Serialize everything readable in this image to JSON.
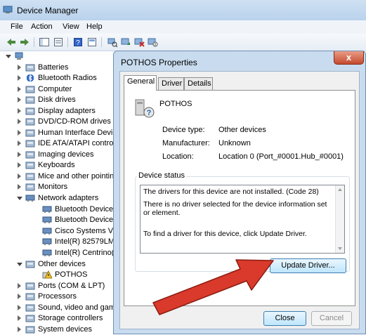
{
  "window": {
    "title": "Device Manager"
  },
  "menu": {
    "items": [
      "File",
      "Action",
      "View",
      "Help"
    ]
  },
  "tree": {
    "items": [
      {
        "label": "Batteries"
      },
      {
        "label": "Bluetooth Radios"
      },
      {
        "label": "Computer"
      },
      {
        "label": "Disk drives"
      },
      {
        "label": "Display adapters"
      },
      {
        "label": "DVD/CD-ROM drives"
      },
      {
        "label": "Human Interface Devic"
      },
      {
        "label": "IDE ATA/ATAPI contro"
      },
      {
        "label": "Imaging devices"
      },
      {
        "label": "Keyboards"
      },
      {
        "label": "Mice and other pointin"
      },
      {
        "label": "Monitors"
      },
      {
        "label": "Network adapters"
      },
      {
        "label": "Bluetooth Device ("
      },
      {
        "label": "Bluetooth Device ("
      },
      {
        "label": "Cisco Systems VPN"
      },
      {
        "label": "Intel(R) 82579LM G"
      },
      {
        "label": "Intel(R) Centrino(R"
      },
      {
        "label": "Other devices"
      },
      {
        "label": "POTHOS"
      },
      {
        "label": "Ports (COM & LPT)"
      },
      {
        "label": "Processors"
      },
      {
        "label": "Sound, video and gam"
      },
      {
        "label": "Storage controllers"
      },
      {
        "label": "System devices"
      }
    ]
  },
  "dialog": {
    "title": "POTHOS Properties",
    "close_glyph": "x",
    "tabs": [
      "General",
      "Driver",
      "Details"
    ],
    "device_name": "POTHOS",
    "properties": [
      {
        "label": "Device type:",
        "value": "Other devices"
      },
      {
        "label": "Manufacturer:",
        "value": "Unknown"
      },
      {
        "label": "Location:",
        "value": "Location 0 (Port_#0001.Hub_#0001)"
      }
    ],
    "status_group_label": "Device status",
    "status_lines": [
      "The drivers for this device are not installed. (Code 28)",
      "There is no driver selected for the device information set or element.",
      "To find a driver for this device, click Update Driver."
    ],
    "update_button": "Update Driver...",
    "close_button": "Close",
    "cancel_button": "Cancel"
  },
  "colors": {
    "annotation_arrow": "#d93a2b",
    "accent": "#3c7fb1"
  }
}
